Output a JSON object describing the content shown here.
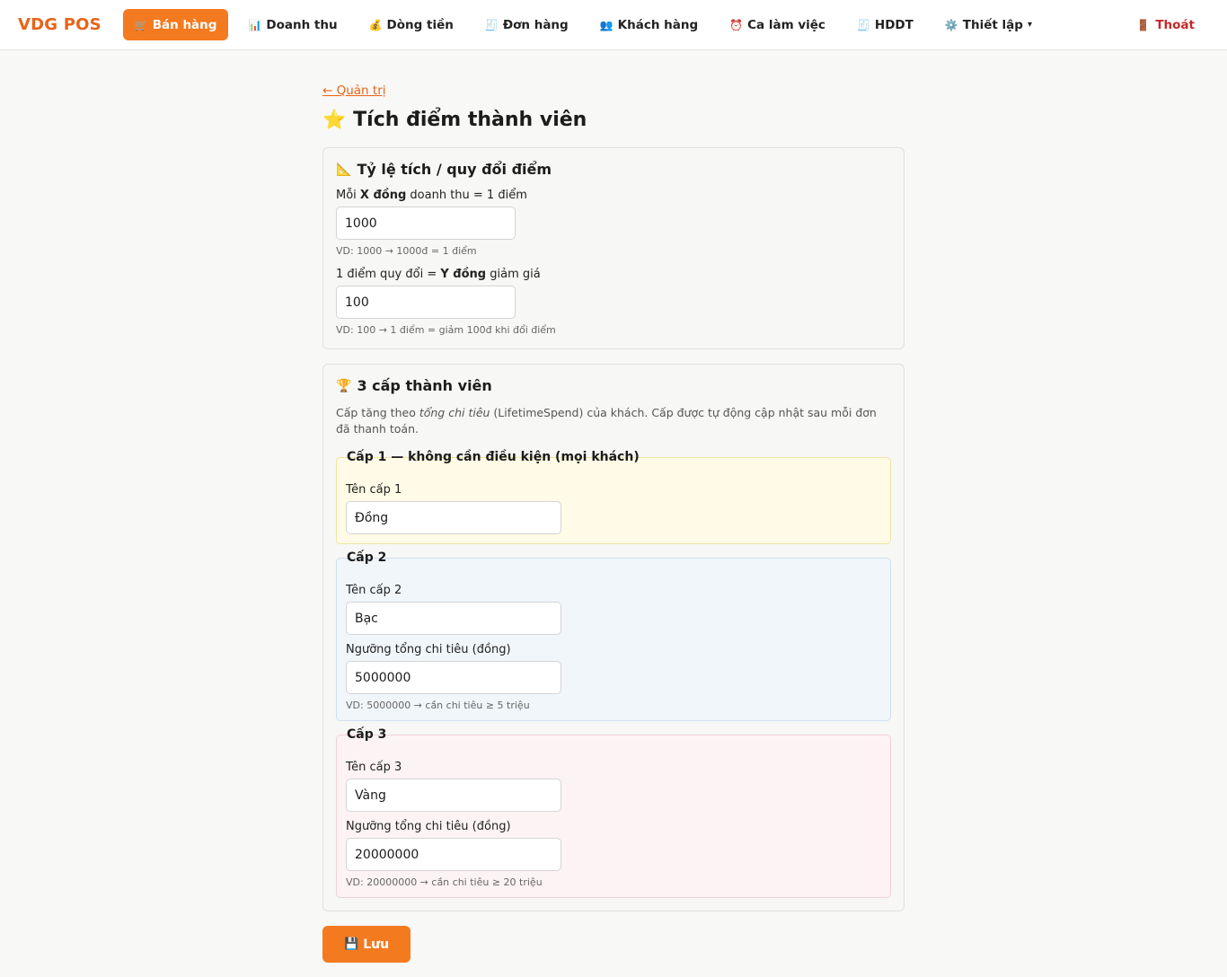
{
  "app": {
    "brand": "VDG POS"
  },
  "nav": {
    "items": [
      {
        "icon": "🛒",
        "label": "Bán hàng"
      },
      {
        "icon": "📊",
        "label": "Doanh thu"
      },
      {
        "icon": "💰",
        "label": "Dòng tiền"
      },
      {
        "icon": "🧾",
        "label": "Đơn hàng"
      },
      {
        "icon": "👥",
        "label": "Khách hàng"
      },
      {
        "icon": "⏰",
        "label": "Ca làm việc"
      },
      {
        "icon": "🧾",
        "label": "HDDT"
      },
      {
        "icon": "⚙️",
        "label": "Thiết lập",
        "caret": "▾"
      }
    ],
    "active_index": 0,
    "logout": {
      "icon": "🚪",
      "label": "Thoát"
    }
  },
  "page": {
    "back_label": "← Quản trị",
    "title_icon": "⭐",
    "title": "Tích điểm thành viên"
  },
  "rate": {
    "title_icon": "📐",
    "title": "Tỷ lệ tích / quy đổi điểm",
    "earn_label_pre": "Mỗi ",
    "earn_label_bold": "X đồng",
    "earn_label_post": " doanh thu = 1 điểm",
    "earn_value": "1000",
    "earn_hint": "VD: 1000 → 1000đ = 1 điểm",
    "redeem_label_pre": "1 điểm quy đổi = ",
    "redeem_label_bold": "Y đồng",
    "redeem_label_post": " giảm giá",
    "redeem_value": "100",
    "redeem_hint": "VD: 100 → 1 điểm = giảm 100đ khi đổi điểm"
  },
  "tiers": {
    "title_icon": "🏆",
    "title": "3 cấp thành viên",
    "desc_pre": "Cấp tăng theo ",
    "desc_italic": "tổng chi tiêu",
    "desc_post": " (LifetimeSpend) của khách. Cấp được tự động cập nhật sau mỗi đơn đã thanh toán.",
    "tier1": {
      "legend": "Cấp 1 — không cần điều kiện (mọi khách)",
      "name_label": "Tên cấp 1",
      "name_value": "Đồng"
    },
    "tier2": {
      "legend": "Cấp 2",
      "name_label": "Tên cấp 2",
      "name_value": "Bạc",
      "threshold_label": "Ngưỡng tổng chi tiêu (đồng)",
      "threshold_value": "5000000",
      "hint": "VD: 5000000 → cần chi tiêu ≥ 5 triệu"
    },
    "tier3": {
      "legend": "Cấp 3",
      "name_label": "Tên cấp 3",
      "name_value": "Vàng",
      "threshold_label": "Ngưỡng tổng chi tiêu (đồng)",
      "threshold_value": "20000000",
      "hint": "VD: 20000000 → cần chi tiêu ≥ 20 triệu"
    }
  },
  "actions": {
    "save_icon": "💾",
    "save_label": "Lưu"
  },
  "colors": {
    "accent": "#f47a20",
    "brand": "#e8641a",
    "danger": "#c62828"
  }
}
